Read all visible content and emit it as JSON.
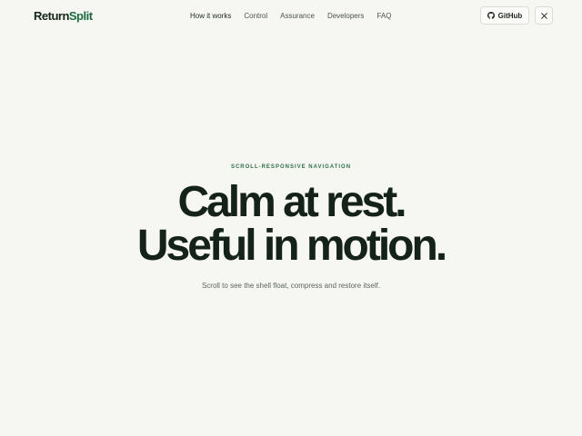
{
  "brand": {
    "part1": "Return",
    "part2": "Split"
  },
  "nav": {
    "links": [
      "How it works",
      "Control",
      "Assurance",
      "Developers",
      "FAQ"
    ],
    "github_label": "GitHub",
    "x_label": "X"
  },
  "hero": {
    "eyebrow": "SCROLL-RESPONSIVE NAVIGATION",
    "headline_line1": "Calm at rest.",
    "headline_line2": "Useful in motion.",
    "subtitle": "Scroll to see the shell float, compress and restore itself."
  },
  "colors": {
    "background": "#f6f6f3",
    "brand_dark": "#15261b",
    "brand_accent": "#1d6a3f",
    "eyebrow": "#2d6e48"
  },
  "icons": {
    "github": "github-icon",
    "x": "x-icon"
  }
}
